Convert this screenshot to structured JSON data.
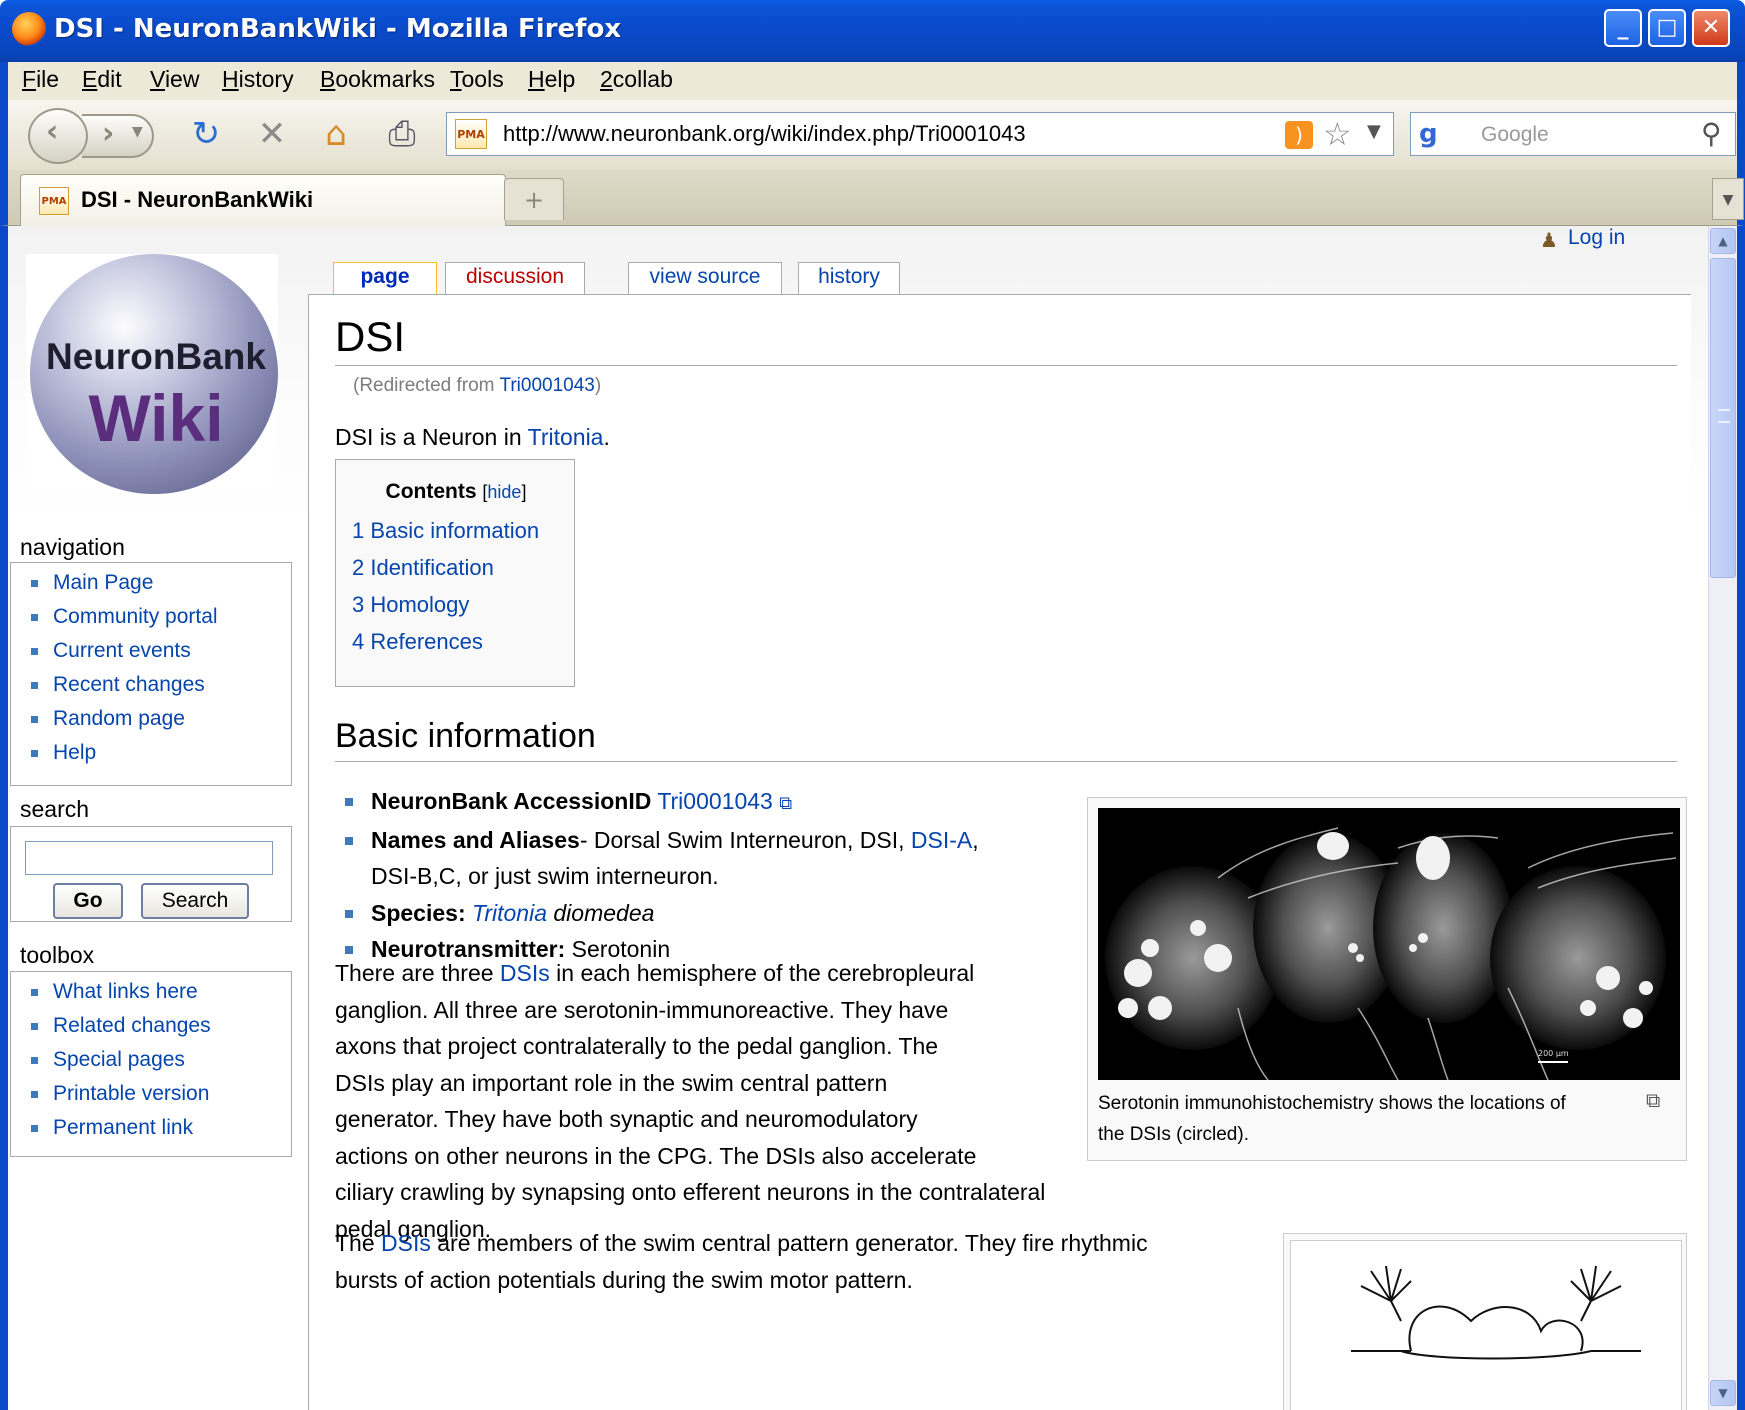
{
  "window": {
    "title": "DSI - NeuronBankWiki - Mozilla Firefox",
    "min": "_",
    "max": "□",
    "close": "✕"
  },
  "menu": [
    {
      "label": "File",
      "u": "F",
      "rest": "ile"
    },
    {
      "label": "Edit",
      "u": "E",
      "rest": "dit"
    },
    {
      "label": "View",
      "u": "V",
      "rest": "iew"
    },
    {
      "label": "History",
      "u": "H",
      "rest": "istory"
    },
    {
      "label": "Bookmarks",
      "u": "B",
      "rest": "ookmarks"
    },
    {
      "label": "Tools",
      "u": "T",
      "rest": "ools"
    },
    {
      "label": "Help",
      "u": "H",
      "rest": "elp"
    },
    {
      "label": "2collab",
      "u": "2",
      "rest": "collab"
    }
  ],
  "nav": {
    "url": "http://www.neuronbank.org/wiki/index.php/Tri0001043",
    "search_placeholder": "Google",
    "icons": [
      "back-icon",
      "forward-icon",
      "reload-icon",
      "stop-icon",
      "home-icon",
      "print-icon",
      "rss-icon",
      "bookmark-star-icon",
      "google-icon",
      "search-magnifier-icon"
    ]
  },
  "tab": {
    "title": "DSI - NeuronBankWiki",
    "favicon": "PMA",
    "newtab": "+"
  },
  "logo": {
    "line1": "NeuronBank",
    "line2": "Wiki"
  },
  "user": {
    "login": "Log in"
  },
  "sidebar": {
    "navigation_title": "navigation",
    "navigation": [
      "Main Page",
      "Community portal",
      "Current events",
      "Recent changes",
      "Random page",
      "Help"
    ],
    "search_title": "search",
    "go": "Go",
    "search": "Search",
    "toolbox_title": "toolbox",
    "toolbox": [
      "What links here",
      "Related changes",
      "Special pages",
      "Printable version",
      "Permanent link"
    ]
  },
  "ptabs": {
    "page": "page",
    "discussion": "discussion",
    "source": "view source",
    "history": "history"
  },
  "article": {
    "title": "DSI",
    "redirect_prefix": "(Redirected from ",
    "redirect_link": "Tri0001043",
    "redirect_suffix": ")",
    "intro_prefix": "DSI is a Neuron in ",
    "intro_link": "Tritonia",
    "intro_suffix": ".",
    "toc_title": "Contents",
    "toc_hide": "hide",
    "toc": [
      "1 Basic information",
      "2 Identification",
      "3 Homology",
      "4 References"
    ],
    "section1": "Basic information",
    "facts": {
      "accession_label": "NeuronBank AccessionID",
      "accession_value": "Tri0001043",
      "names_label": "Names and Aliases",
      "names_text1": "- Dorsal Swim Interneuron, DSI, ",
      "names_link": "DSI-A",
      "names_text2": ",",
      "names_line2": "DSI-B,C, or just swim interneuron.",
      "species_label": "Species:",
      "species_link": "Tritonia",
      "species_rest": " diomedea",
      "nt_label": "Neurotransmitter:",
      "nt_value": " Serotonin"
    },
    "para1": {
      "l1a": "There are three ",
      "l1link": "DSIs",
      "l1b": " in each hemisphere of the cerebropleural",
      "l2": "ganglion. All three are serotonin-immunoreactive. They have",
      "l3": "axons that project contralaterally to the pedal ganglion. The",
      "l4": "DSIs play an important role in the swim central pattern",
      "l5": "generator. They have both synaptic and neuromodulatory",
      "l6": "actions on other neurons in the CPG. The DSIs also accelerate",
      "l7": "ciliary crawling by synapsing onto efferent neurons in the contralateral pedal ganglion."
    },
    "para2": {
      "l1a": "The ",
      "l1link": "DSIs",
      "l1b": " are members of the swim central pattern generator. They fire rhythmic",
      "l2": "bursts of action potentials during the swim motor pattern."
    },
    "figure1_caption_l1": "Serotonin immunohistochemistry shows the locations of",
    "figure1_caption_l2": "the DSIs (circled).",
    "figure1_scale": "200 μm"
  },
  "colors": {
    "link": "#0645ad",
    "titlebar": "#0a49c9",
    "discussion": "#ba0000"
  }
}
